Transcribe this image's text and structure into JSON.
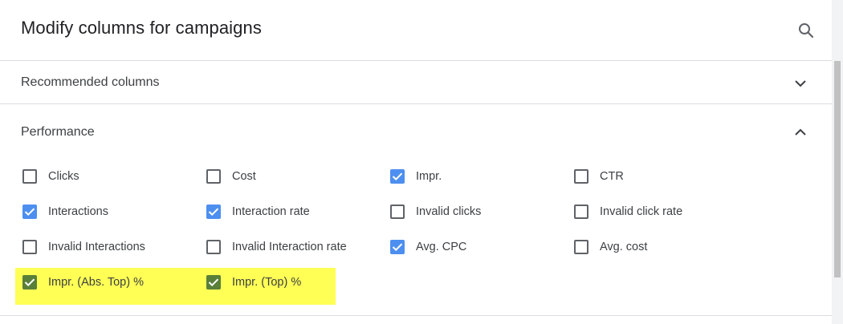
{
  "dialog": {
    "title": "Modify columns for campaigns",
    "search_icon": "search-icon"
  },
  "sections": {
    "recommended": {
      "label": "Recommended columns",
      "expanded": false,
      "icon": "chevron-down-icon"
    },
    "performance": {
      "label": "Performance",
      "expanded": true,
      "icon": "chevron-up-icon"
    }
  },
  "performance_columns": [
    {
      "label": "Clicks",
      "checked": false
    },
    {
      "label": "Cost",
      "checked": false
    },
    {
      "label": "Impr.",
      "checked": true
    },
    {
      "label": "CTR",
      "checked": false
    },
    {
      "label": "Interactions",
      "checked": true
    },
    {
      "label": "Interaction rate",
      "checked": true
    },
    {
      "label": "Invalid clicks",
      "checked": false
    },
    {
      "label": "Invalid click rate",
      "checked": false
    },
    {
      "label": "Invalid Interactions",
      "checked": false
    },
    {
      "label": "Invalid Interaction rate",
      "checked": false
    },
    {
      "label": "Avg. CPC",
      "checked": true
    },
    {
      "label": "Avg. cost",
      "checked": false
    },
    {
      "label": "Impr. (Abs. Top) %",
      "checked": true,
      "highlighted": true
    },
    {
      "label": "Impr. (Top) %",
      "checked": true,
      "highlighted": true
    }
  ],
  "colors": {
    "checkbox_checked": "#4d8ff0",
    "highlight": "#ffff55",
    "highlight_checkbox": "#5a7f3a"
  }
}
